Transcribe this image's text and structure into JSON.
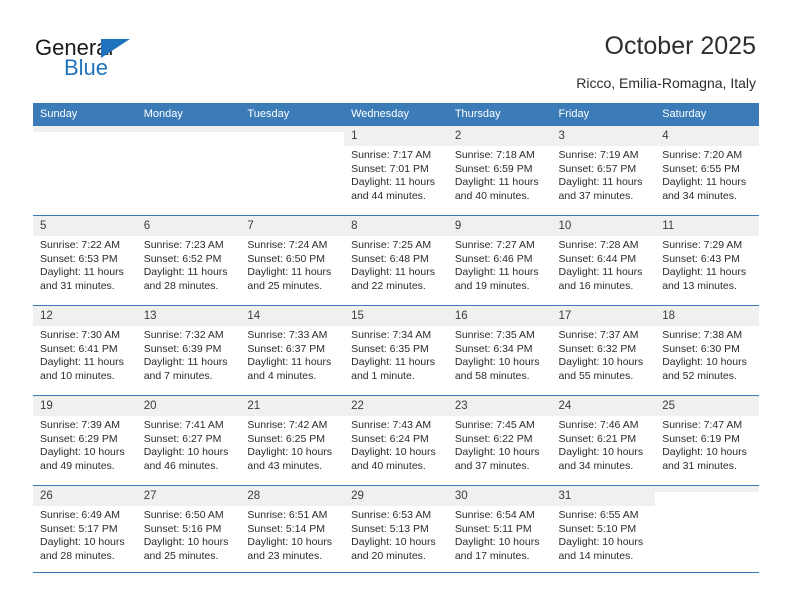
{
  "brand": {
    "name_top": "General",
    "name_bottom": "Blue",
    "accent_color": "#1f73bd",
    "triangle_icon": "triangle-icon"
  },
  "header": {
    "title": "October 2025",
    "subtitle": "Ricco, Emilia-Romagna, Italy"
  },
  "theme": {
    "header_bg": "#3b7cb8",
    "header_text": "#ffffff",
    "daynum_bg": "#f0f0f0",
    "cell_bg": "#ffffff",
    "body_text": "#2b2b2b"
  },
  "weekday_headers": [
    "Sunday",
    "Monday",
    "Tuesday",
    "Wednesday",
    "Thursday",
    "Friday",
    "Saturday"
  ],
  "labels": {
    "sunrise_prefix": "Sunrise:",
    "sunset_prefix": "Sunset:",
    "daylight_prefix": "Daylight:"
  },
  "weeks": [
    [
      {
        "day": "",
        "empty": true,
        "line1": "",
        "line2": "",
        "line3": "",
        "line4": ""
      },
      {
        "day": "",
        "empty": true,
        "line1": "",
        "line2": "",
        "line3": "",
        "line4": ""
      },
      {
        "day": "",
        "empty": true,
        "line1": "",
        "line2": "",
        "line3": "",
        "line4": ""
      },
      {
        "day": "1",
        "empty": false,
        "line1": "Sunrise: 7:17 AM",
        "line2": "Sunset: 7:01 PM",
        "line3": "Daylight: 11 hours",
        "line4": "and 44 minutes."
      },
      {
        "day": "2",
        "empty": false,
        "line1": "Sunrise: 7:18 AM",
        "line2": "Sunset: 6:59 PM",
        "line3": "Daylight: 11 hours",
        "line4": "and 40 minutes."
      },
      {
        "day": "3",
        "empty": false,
        "line1": "Sunrise: 7:19 AM",
        "line2": "Sunset: 6:57 PM",
        "line3": "Daylight: 11 hours",
        "line4": "and 37 minutes."
      },
      {
        "day": "4",
        "empty": false,
        "line1": "Sunrise: 7:20 AM",
        "line2": "Sunset: 6:55 PM",
        "line3": "Daylight: 11 hours",
        "line4": "and 34 minutes."
      }
    ],
    [
      {
        "day": "5",
        "empty": false,
        "line1": "Sunrise: 7:22 AM",
        "line2": "Sunset: 6:53 PM",
        "line3": "Daylight: 11 hours",
        "line4": "and 31 minutes."
      },
      {
        "day": "6",
        "empty": false,
        "line1": "Sunrise: 7:23 AM",
        "line2": "Sunset: 6:52 PM",
        "line3": "Daylight: 11 hours",
        "line4": "and 28 minutes."
      },
      {
        "day": "7",
        "empty": false,
        "line1": "Sunrise: 7:24 AM",
        "line2": "Sunset: 6:50 PM",
        "line3": "Daylight: 11 hours",
        "line4": "and 25 minutes."
      },
      {
        "day": "8",
        "empty": false,
        "line1": "Sunrise: 7:25 AM",
        "line2": "Sunset: 6:48 PM",
        "line3": "Daylight: 11 hours",
        "line4": "and 22 minutes."
      },
      {
        "day": "9",
        "empty": false,
        "line1": "Sunrise: 7:27 AM",
        "line2": "Sunset: 6:46 PM",
        "line3": "Daylight: 11 hours",
        "line4": "and 19 minutes."
      },
      {
        "day": "10",
        "empty": false,
        "line1": "Sunrise: 7:28 AM",
        "line2": "Sunset: 6:44 PM",
        "line3": "Daylight: 11 hours",
        "line4": "and 16 minutes."
      },
      {
        "day": "11",
        "empty": false,
        "line1": "Sunrise: 7:29 AM",
        "line2": "Sunset: 6:43 PM",
        "line3": "Daylight: 11 hours",
        "line4": "and 13 minutes."
      }
    ],
    [
      {
        "day": "12",
        "empty": false,
        "line1": "Sunrise: 7:30 AM",
        "line2": "Sunset: 6:41 PM",
        "line3": "Daylight: 11 hours",
        "line4": "and 10 minutes."
      },
      {
        "day": "13",
        "empty": false,
        "line1": "Sunrise: 7:32 AM",
        "line2": "Sunset: 6:39 PM",
        "line3": "Daylight: 11 hours",
        "line4": "and 7 minutes."
      },
      {
        "day": "14",
        "empty": false,
        "line1": "Sunrise: 7:33 AM",
        "line2": "Sunset: 6:37 PM",
        "line3": "Daylight: 11 hours",
        "line4": "and 4 minutes."
      },
      {
        "day": "15",
        "empty": false,
        "line1": "Sunrise: 7:34 AM",
        "line2": "Sunset: 6:35 PM",
        "line3": "Daylight: 11 hours",
        "line4": "and 1 minute."
      },
      {
        "day": "16",
        "empty": false,
        "line1": "Sunrise: 7:35 AM",
        "line2": "Sunset: 6:34 PM",
        "line3": "Daylight: 10 hours",
        "line4": "and 58 minutes."
      },
      {
        "day": "17",
        "empty": false,
        "line1": "Sunrise: 7:37 AM",
        "line2": "Sunset: 6:32 PM",
        "line3": "Daylight: 10 hours",
        "line4": "and 55 minutes."
      },
      {
        "day": "18",
        "empty": false,
        "line1": "Sunrise: 7:38 AM",
        "line2": "Sunset: 6:30 PM",
        "line3": "Daylight: 10 hours",
        "line4": "and 52 minutes."
      }
    ],
    [
      {
        "day": "19",
        "empty": false,
        "line1": "Sunrise: 7:39 AM",
        "line2": "Sunset: 6:29 PM",
        "line3": "Daylight: 10 hours",
        "line4": "and 49 minutes."
      },
      {
        "day": "20",
        "empty": false,
        "line1": "Sunrise: 7:41 AM",
        "line2": "Sunset: 6:27 PM",
        "line3": "Daylight: 10 hours",
        "line4": "and 46 minutes."
      },
      {
        "day": "21",
        "empty": false,
        "line1": "Sunrise: 7:42 AM",
        "line2": "Sunset: 6:25 PM",
        "line3": "Daylight: 10 hours",
        "line4": "and 43 minutes."
      },
      {
        "day": "22",
        "empty": false,
        "line1": "Sunrise: 7:43 AM",
        "line2": "Sunset: 6:24 PM",
        "line3": "Daylight: 10 hours",
        "line4": "and 40 minutes."
      },
      {
        "day": "23",
        "empty": false,
        "line1": "Sunrise: 7:45 AM",
        "line2": "Sunset: 6:22 PM",
        "line3": "Daylight: 10 hours",
        "line4": "and 37 minutes."
      },
      {
        "day": "24",
        "empty": false,
        "line1": "Sunrise: 7:46 AM",
        "line2": "Sunset: 6:21 PM",
        "line3": "Daylight: 10 hours",
        "line4": "and 34 minutes."
      },
      {
        "day": "25",
        "empty": false,
        "line1": "Sunrise: 7:47 AM",
        "line2": "Sunset: 6:19 PM",
        "line3": "Daylight: 10 hours",
        "line4": "and 31 minutes."
      }
    ],
    [
      {
        "day": "26",
        "empty": false,
        "line1": "Sunrise: 6:49 AM",
        "line2": "Sunset: 5:17 PM",
        "line3": "Daylight: 10 hours",
        "line4": "and 28 minutes."
      },
      {
        "day": "27",
        "empty": false,
        "line1": "Sunrise: 6:50 AM",
        "line2": "Sunset: 5:16 PM",
        "line3": "Daylight: 10 hours",
        "line4": "and 25 minutes."
      },
      {
        "day": "28",
        "empty": false,
        "line1": "Sunrise: 6:51 AM",
        "line2": "Sunset: 5:14 PM",
        "line3": "Daylight: 10 hours",
        "line4": "and 23 minutes."
      },
      {
        "day": "29",
        "empty": false,
        "line1": "Sunrise: 6:53 AM",
        "line2": "Sunset: 5:13 PM",
        "line3": "Daylight: 10 hours",
        "line4": "and 20 minutes."
      },
      {
        "day": "30",
        "empty": false,
        "line1": "Sunrise: 6:54 AM",
        "line2": "Sunset: 5:11 PM",
        "line3": "Daylight: 10 hours",
        "line4": "and 17 minutes."
      },
      {
        "day": "31",
        "empty": false,
        "line1": "Sunrise: 6:55 AM",
        "line2": "Sunset: 5:10 PM",
        "line3": "Daylight: 10 hours",
        "line4": "and 14 minutes."
      },
      {
        "day": "",
        "empty": true,
        "line1": "",
        "line2": "",
        "line3": "",
        "line4": ""
      }
    ]
  ]
}
